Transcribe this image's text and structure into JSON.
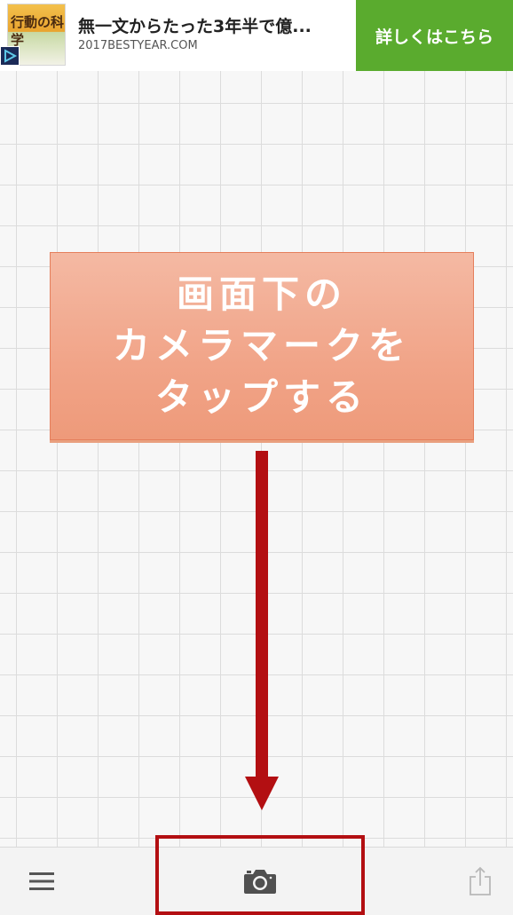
{
  "ad": {
    "title": "無一文からたった3年半で億...",
    "url": "2017BESTYEAR.COM",
    "cta_label": "詳しくはこちら",
    "thumbnail_text": "行動の科学",
    "thumbnail_icon": "play-badge-icon",
    "cta_color": "#5aab2e"
  },
  "callout": {
    "lines": [
      "画面下の",
      "カメラマークを",
      "タップする"
    ],
    "background_color": "#f1a488",
    "text_color": "#ffffff"
  },
  "annotation": {
    "arrow_color": "#b30f12",
    "highlight_color": "#b30f12"
  },
  "toolbar": {
    "menu_icon": "hamburger-menu-icon",
    "camera_icon": "camera-icon",
    "share_icon": "share-icon"
  }
}
